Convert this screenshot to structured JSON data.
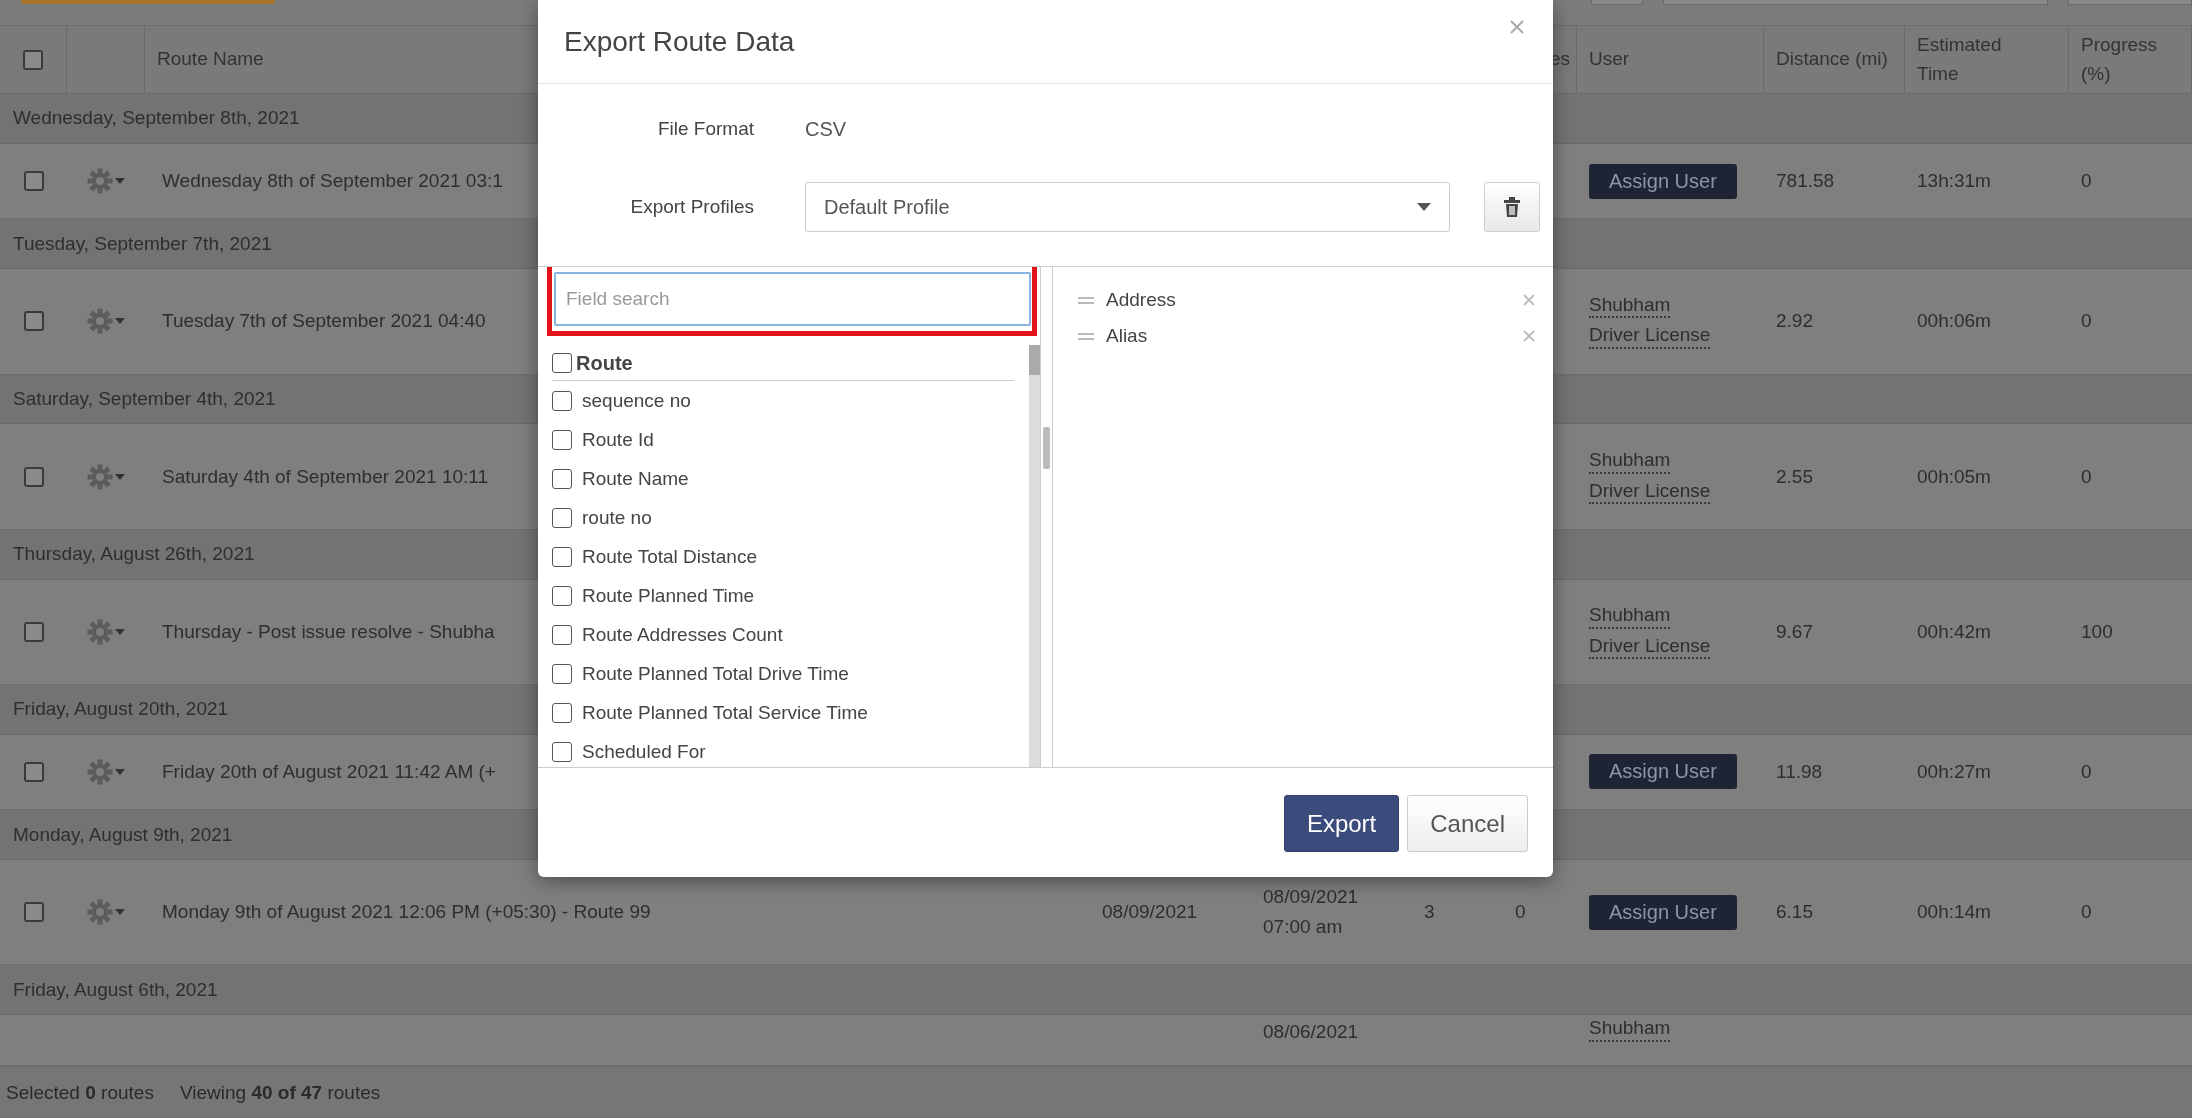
{
  "table": {
    "select_all": {
      "checked": false
    },
    "columns": [
      {
        "kind": "select"
      },
      {
        "kind": "blank"
      },
      {
        "kind": "text",
        "label": "Route Name"
      },
      {
        "kind": "blank"
      },
      {
        "kind": "blank"
      },
      {
        "kind": "blank"
      },
      {
        "kind": "text",
        "label": "es"
      },
      {
        "kind": "text",
        "label": "User"
      },
      {
        "kind": "text",
        "label": "Distance (mi)"
      },
      {
        "kind": "text",
        "label": "Estimated Time"
      },
      {
        "kind": "text",
        "label": "Progress (%)"
      }
    ],
    "rows": [
      {
        "kind": "group",
        "label": "Wednesday, September 8th, 2021"
      },
      {
        "kind": "route",
        "checked": false,
        "name": "Wednesday 8th of September 2021 03:1",
        "user": {
          "kind": "assign",
          "label": "Assign User"
        },
        "distance": "781.58",
        "time": "13h:31m",
        "progress": "0"
      },
      {
        "kind": "group",
        "label": "Tuesday, September 7th, 2021"
      },
      {
        "kind": "route",
        "checked": false,
        "name": "Tuesday 7th of September 2021 04:40",
        "user": {
          "kind": "driver",
          "lines": [
            "Shubham",
            "Driver License"
          ]
        },
        "distance": "2.92",
        "time": "00h:06m",
        "progress": "0"
      },
      {
        "kind": "group",
        "label": "Saturday, September 4th, 2021"
      },
      {
        "kind": "route",
        "checked": false,
        "name": "Saturday 4th of September 2021 10:11",
        "user": {
          "kind": "driver",
          "lines": [
            "Shubham",
            "Driver License"
          ]
        },
        "distance": "2.55",
        "time": "00h:05m",
        "progress": "0"
      },
      {
        "kind": "group",
        "label": "Thursday, August 26th, 2021"
      },
      {
        "kind": "route",
        "checked": false,
        "name": "Thursday - Post issue resolve - Shubha",
        "user": {
          "kind": "driver",
          "lines": [
            "Shubham",
            "Driver License"
          ]
        },
        "distance": "9.67",
        "time": "00h:42m",
        "progress": "100"
      },
      {
        "kind": "group",
        "label": "Friday, August 20th, 2021"
      },
      {
        "kind": "route",
        "checked": false,
        "name": "Friday 20th of August 2021 11:42 AM (+",
        "user": {
          "kind": "assign",
          "label": "Assign User"
        },
        "distance": "11.98",
        "time": "00h:27m",
        "progress": "0"
      },
      {
        "kind": "group",
        "label": "Monday, August 9th, 2021"
      },
      {
        "kind": "route",
        "checked": false,
        "name": "Monday 9th of August 2021 12:06 PM (+05:30) - Route 99",
        "date": "08/09/2021",
        "scheduled": [
          "08/09/2021",
          "07:00 am"
        ],
        "column_3": "3",
        "column_4": "0",
        "user": {
          "kind": "assign",
          "label": "Assign User"
        },
        "distance": "6.15",
        "time": "00h:14m",
        "progress": "0"
      },
      {
        "kind": "group",
        "label": "Friday, August 6th, 2021"
      },
      {
        "kind": "route",
        "scheduled": [
          "08/06/2021"
        ],
        "user": {
          "kind": "driver",
          "lines": [
            "Shubham"
          ]
        }
      }
    ]
  },
  "status_bar": {
    "selected": "Selected **0** routes",
    "viewing": "Viewing **40 of 47** routes"
  },
  "modal": {
    "title": "Export Route Data",
    "file_format": {
      "label": "File Format",
      "value": "CSV"
    },
    "export_profiles": {
      "label": "Export Profiles",
      "value": "Default Profile"
    },
    "field_search": {
      "placeholder": "Field search",
      "highlighted": true
    },
    "field_groups": [
      {
        "label": "Route",
        "checked": false,
        "fields": [
          {
            "label": "sequence no",
            "checked": false
          },
          {
            "label": "Route Id",
            "checked": false
          },
          {
            "label": "Route Name",
            "checked": false
          },
          {
            "label": "route no",
            "checked": false
          },
          {
            "label": "Route Total Distance",
            "checked": false
          },
          {
            "label": "Route Planned Time",
            "checked": false
          },
          {
            "label": "Route Addresses Count",
            "checked": false
          },
          {
            "label": "Route Planned Total Drive Time",
            "checked": false
          },
          {
            "label": "Route Planned Total Service Time",
            "checked": false
          },
          {
            "label": "Scheduled For",
            "checked": false
          }
        ]
      }
    ],
    "selected_fields": [
      {
        "label": "Address"
      },
      {
        "label": "Alias"
      }
    ],
    "buttons": [
      {
        "label": "Export",
        "kind": "primary"
      },
      {
        "label": "Cancel",
        "kind": "default"
      }
    ]
  }
}
